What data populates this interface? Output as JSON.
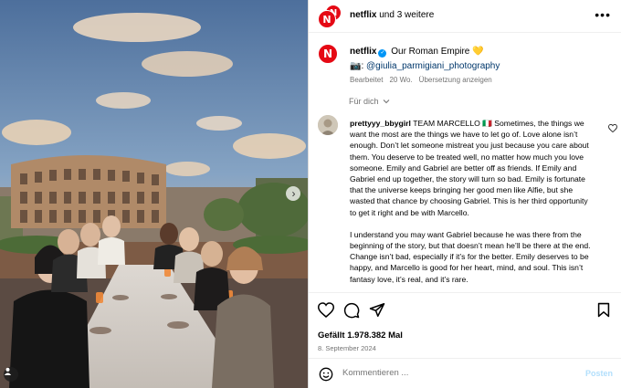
{
  "header": {
    "account": "netflix",
    "others": "und 3 weitere",
    "more_icon": "more-horizontal-icon"
  },
  "caption": {
    "account": "netflix",
    "title": "Our Roman Empire 💛",
    "camera_emoji": "📷",
    "colon": ":",
    "mention": "@giulia_parmigiani_photography",
    "edited": "Bearbeitet",
    "age": "20 Wo.",
    "translate": "Übersetzung anzeigen"
  },
  "filter": {
    "label": "Für dich"
  },
  "comment": {
    "username": "prettyyy_bbygirl",
    "text1": "TEAM MARCELLO 🇮🇹 Sometimes, the things we want the most are the things we have to let go of. Love alone isn’t enough. Don’t let someone mistreat you just because you care about them. You deserve to be treated well, no matter how much you love someone. Emily and Gabriel are better off as friends. If Emily and Gabriel end up together, the story will turn so bad. Emily is fortunate that the universe keeps bringing her good men like Alfie, but she wasted that chance by choosing Gabriel. This is her third opportunity to get it right and be with Marcello.",
    "text2": "I understand you may want Gabriel because he was there from the beginning of the story, but that doesn’t mean he’ll be there at the end. Change isn’t bad, especially if it’s for the better. Emily deserves to be happy, and Marcello is good for her heart, mind, and soul. This isn’t fantasy love, it’s real, and it’s rare."
  },
  "actions": {
    "likes": "Gefällt 1.978.382 Mal",
    "date": "8. September 2024"
  },
  "comment_input": {
    "placeholder": "Kommentieren ...",
    "post_label": "Posten"
  },
  "colors": {
    "netflix_red": "#e50914",
    "link": "#00376b",
    "verified": "#0095f6",
    "muted": "#737373",
    "post_disabled": "#b2dffc"
  }
}
